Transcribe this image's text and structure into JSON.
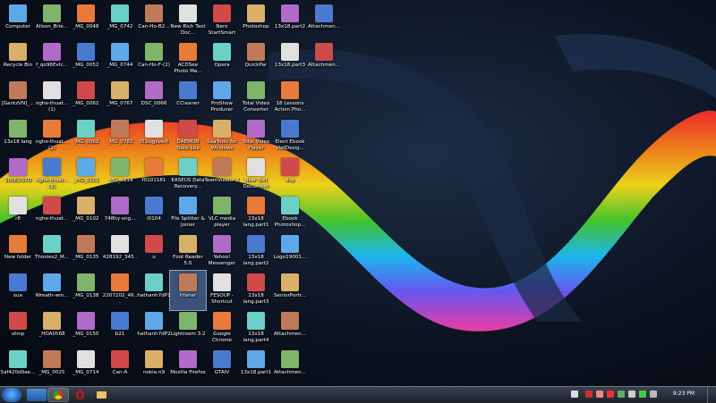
{
  "desktop": {
    "columns": [
      [
        "Computer",
        "Recycle Bin",
        "[GantzVN]_...",
        "13x18 lang",
        "100EOS7D",
        "r8",
        "New folder",
        "sua",
        "utmp",
        "5af420d0ae..."
      ],
      [
        "Alison_Brie...",
        "f_qo96EvIc...",
        "nghe-thuat...\n(1)",
        "nghe-thuat...\n(2)",
        "nghe-thuat...\n(3)",
        "nghe-thuat...",
        "Thonies2_M...",
        "Wreath-win...",
        "_HOA0568",
        "_MG_0025"
      ],
      [
        "_MG_0048",
        "_MG_0052",
        "_MG_0062",
        "_MG_0062",
        "_MG_0101",
        "_MG_0102",
        "_MG_0135",
        "_MG_0138",
        "_MG_0150",
        "_MG_0714"
      ],
      [
        "_MG_0742",
        "_MG_0744",
        "_MG_0767",
        "_MG_0782",
        "_MG_9814",
        "748hy-sng...",
        "428192_345...",
        "2207202_46...",
        "b21",
        "Can-A"
      ],
      [
        "Can-Ho-B2...",
        "Can-Ho-F-(2)",
        "DSC_0066",
        "f01logovert",
        "f0101181",
        "i0104",
        "u",
        "hathanh7dP1",
        "hathanh7dP2",
        "nokia n9"
      ],
      [
        "New Rich Text Doc...",
        "ACDSee Photo Ma...",
        "CCleaner",
        "DAEMON Tools Lite",
        "EASEUS Data Recovery...",
        "File Splitter & Joiner",
        "Foot Reader 5.0",
        "Irfaner",
        "Lightroom 3.2",
        "Mozilla Firefox"
      ],
      [
        "Nero StartSmart",
        "Opera",
        "ProShow Producer",
        "SeaTools for Windows",
        "TeamViewer 7",
        "VLC media player",
        "Yahoo! Messenger",
        "FESOUP - Shortcut",
        "Google Chrome",
        "GTAIV"
      ],
      [
        "Photoshop",
        "QuickPar",
        "Total Video Converter",
        "Total Video Player",
        "New Text Document",
        "13x18 lang.part1",
        "13x18 lang.part2",
        "13x18 lang.part3",
        "13x18 lang.part4",
        "13x18.part1"
      ],
      [
        "13x18.part2",
        "13x18.part3",
        "18 Lessons Action Pho...",
        "Elent Ebook VietDesig...",
        "duy",
        "Ebook Photoshop...",
        "Logo19001...",
        "SeniorPortr...",
        "Attachmen...",
        "Attachmen..."
      ],
      [
        "Attachmen...",
        "Attachmen..."
      ]
    ],
    "selected": [
      5,
      7
    ]
  },
  "taskbar": {
    "clock": "9:23 PM",
    "pinned": [
      "windows-explorer",
      "internet-explorer",
      "chrome",
      "opera",
      "folder"
    ],
    "colors": {
      "start": "#1b5fb5",
      "taskbar": "#1b2029"
    }
  }
}
